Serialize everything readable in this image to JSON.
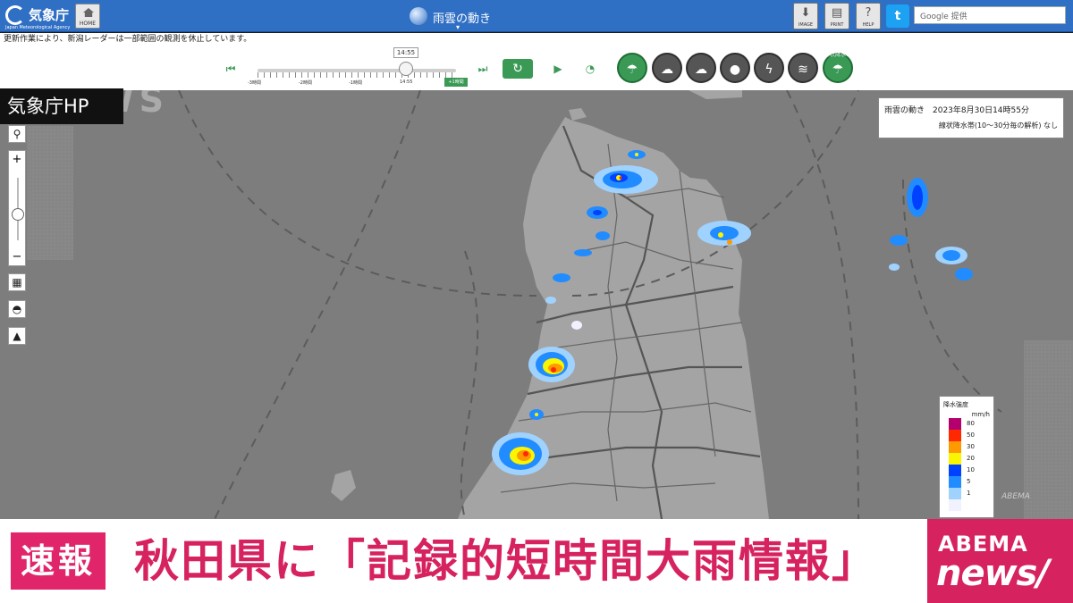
{
  "header": {
    "logo_text": "気象庁",
    "logo_en": "Japan Meteorological Agency",
    "home_label": "HOME",
    "page_title": "雨雲の動き",
    "image_label": "IMAGE",
    "print_label": "PRINT",
    "help_label": "HELP",
    "twitter_label": "t",
    "search_placeholder": "Google 提供"
  },
  "notice": "更新作業により、新潟レーダーは一部範囲の観測を休止しています。",
  "controls": {
    "time_display": "14:55",
    "tick_labels": [
      "-3時間",
      "-2時間",
      "-1時間",
      "14:55"
    ],
    "tick_now": "+1時間",
    "layer_sub_label": "線状降水帯"
  },
  "map_overlay": {
    "jma_hp": "気象庁HP",
    "news_watermark": "NEWS",
    "info_line1": "雨雲の動き　2023年8月30日14時55分",
    "info_line2": "線状降水帯(10〜30分毎の解析) なし",
    "mini_watermark": "ABEMA"
  },
  "legend": {
    "title": "降水強度",
    "unit": "mm/h",
    "items": [
      {
        "label": "80",
        "color": "#b4006e"
      },
      {
        "label": "50",
        "color": "#ff2800"
      },
      {
        "label": "30",
        "color": "#ff9900"
      },
      {
        "label": "20",
        "color": "#faf500"
      },
      {
        "label": "10",
        "color": "#0041ff"
      },
      {
        "label": "5",
        "color": "#218cff"
      },
      {
        "label": "1",
        "color": "#a0d2ff"
      },
      {
        "label": "",
        "color": "#f2f2ff"
      }
    ]
  },
  "banner": {
    "tag": "速報",
    "headline": "秋田県に「記録的短時間大雨情報」",
    "brand_top": "ABEMA",
    "brand_bottom": "news/"
  },
  "colors": {
    "header_bg": "#2f6fc4",
    "accent_green": "#3a9a55",
    "banner_pink": "#d6225f"
  }
}
